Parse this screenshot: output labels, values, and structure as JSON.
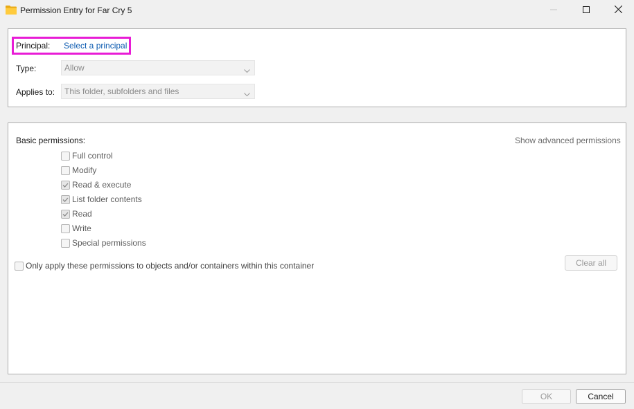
{
  "window": {
    "title": "Permission Entry for Far Cry 5",
    "app_icon": "folder-icon",
    "controls": [
      "minimize-icon",
      "maximize-icon",
      "close-icon"
    ]
  },
  "principal": {
    "label": "Principal:",
    "link": "Select a principal",
    "highlight_color": "#e81cd6"
  },
  "type": {
    "label": "Type:",
    "value": "Allow"
  },
  "applies_to": {
    "label": "Applies to:",
    "value": "This folder, subfolders and files"
  },
  "permissions": {
    "heading": "Basic permissions:",
    "advanced_link": "Show advanced permissions",
    "items": [
      {
        "label": "Full control",
        "checked": false
      },
      {
        "label": "Modify",
        "checked": false
      },
      {
        "label": "Read & execute",
        "checked": true
      },
      {
        "label": "List folder contents",
        "checked": true
      },
      {
        "label": "Read",
        "checked": true
      },
      {
        "label": "Write",
        "checked": false
      },
      {
        "label": "Special permissions",
        "checked": false
      }
    ],
    "only_apply": {
      "label": "Only apply these permissions to objects and/or containers within this container",
      "checked": false
    },
    "clear_all": "Clear all"
  },
  "footer": {
    "ok": "OK",
    "cancel": "Cancel"
  },
  "colors": {
    "link": "#0b5ab0",
    "disabled_text": "#8a8a8a"
  }
}
